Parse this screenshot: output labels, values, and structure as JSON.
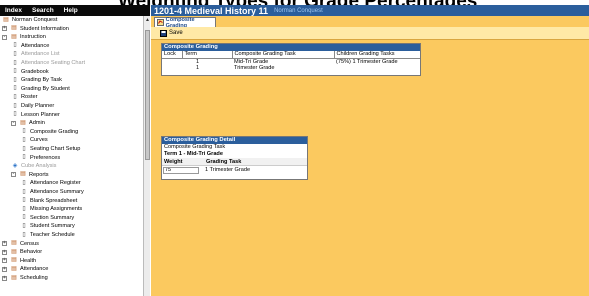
{
  "banner_text": "Weighting Types for Grade Percentages",
  "topnav": [
    "Index",
    "Search",
    "Help"
  ],
  "tree": {
    "items": [
      {
        "label": "Norman Conquest",
        "icon": "folder-icon",
        "level": 0,
        "toggle": "",
        "dim": false
      },
      {
        "label": "Student Information",
        "icon": "folder-icon",
        "level": 0,
        "toggle": "+",
        "dim": false
      },
      {
        "label": "Instruction",
        "icon": "folder-icon",
        "level": 0,
        "toggle": "-",
        "dim": false
      },
      {
        "label": "Attendance",
        "icon": "page-icon",
        "level": 1,
        "toggle": "",
        "dim": false
      },
      {
        "label": "Attendance List",
        "icon": "page-icon",
        "level": 1,
        "toggle": "",
        "dim": true
      },
      {
        "label": "Attendance Seating Chart",
        "icon": "page-icon",
        "level": 1,
        "toggle": "",
        "dim": true
      },
      {
        "label": "Gradebook",
        "icon": "page-icon",
        "level": 1,
        "toggle": "",
        "dim": false
      },
      {
        "label": "Grading By Task",
        "icon": "page-icon",
        "level": 1,
        "toggle": "",
        "dim": false
      },
      {
        "label": "Grading By Student",
        "icon": "page-icon",
        "level": 1,
        "toggle": "",
        "dim": false
      },
      {
        "label": "Roster",
        "icon": "page-icon",
        "level": 1,
        "toggle": "",
        "dim": false
      },
      {
        "label": "Daily Planner",
        "icon": "page-icon",
        "level": 1,
        "toggle": "",
        "dim": false
      },
      {
        "label": "Lesson Planner",
        "icon": "page-icon",
        "level": 1,
        "toggle": "",
        "dim": false
      },
      {
        "label": "Admin",
        "icon": "folder-icon",
        "level": 1,
        "toggle": "-",
        "dim": false
      },
      {
        "label": "Composite Grading",
        "icon": "page-icon",
        "level": 2,
        "toggle": "",
        "dim": false
      },
      {
        "label": "Curves",
        "icon": "page-icon",
        "level": 2,
        "toggle": "",
        "dim": false
      },
      {
        "label": "Seating Chart Setup",
        "icon": "page-icon",
        "level": 2,
        "toggle": "",
        "dim": false
      },
      {
        "label": "Preferences",
        "icon": "page-icon",
        "level": 2,
        "toggle": "",
        "dim": false
      },
      {
        "label": "Cube Analysis",
        "icon": "cube-icon",
        "level": 1,
        "toggle": "",
        "dim": true
      },
      {
        "label": "Reports",
        "icon": "folder-icon",
        "level": 1,
        "toggle": "-",
        "dim": false
      },
      {
        "label": "Attendance Register",
        "icon": "page-icon",
        "level": 2,
        "toggle": "",
        "dim": false
      },
      {
        "label": "Attendance Summary",
        "icon": "page-icon",
        "level": 2,
        "toggle": "",
        "dim": false
      },
      {
        "label": "Blank Spreadsheet",
        "icon": "page-icon",
        "level": 2,
        "toggle": "",
        "dim": false
      },
      {
        "label": "Missing Assignments",
        "icon": "page-icon",
        "level": 2,
        "toggle": "",
        "dim": false
      },
      {
        "label": "Section Summary",
        "icon": "page-icon",
        "level": 2,
        "toggle": "",
        "dim": false
      },
      {
        "label": "Student Summary",
        "icon": "page-icon",
        "level": 2,
        "toggle": "",
        "dim": false
      },
      {
        "label": "Teacher Schedule",
        "icon": "page-icon",
        "level": 2,
        "toggle": "",
        "dim": false
      },
      {
        "label": "Census",
        "icon": "folder-icon",
        "level": 0,
        "toggle": "+",
        "dim": false
      },
      {
        "label": "Behavior",
        "icon": "folder-icon",
        "level": 0,
        "toggle": "+",
        "dim": false
      },
      {
        "label": "Health",
        "icon": "folder-icon",
        "level": 0,
        "toggle": "+",
        "dim": false
      },
      {
        "label": "Attendance",
        "icon": "folder-icon",
        "level": 0,
        "toggle": "+",
        "dim": false
      },
      {
        "label": "Scheduling",
        "icon": "folder-icon",
        "level": 0,
        "toggle": "+",
        "dim": false
      }
    ]
  },
  "header": {
    "title": "1201-4 Medieval History 11",
    "subtitle": "Norman Conquest"
  },
  "tab_label": "Composite Grading",
  "toolbar": {
    "save_label": "Save"
  },
  "composite_panel": {
    "title": "Composite Grading",
    "columns": [
      "Lock",
      "Term",
      "Composite Grading Task",
      "Children Grading Tasks"
    ],
    "rows": [
      [
        "",
        "1",
        "Mid-Tri Grade",
        "(75%) 1 Trimester Grade"
      ],
      [
        "",
        "1",
        "Trimester Grade",
        ""
      ]
    ]
  },
  "detail_panel": {
    "title": "Composite Grading Detail",
    "task_label": "Composite Grading Task",
    "term_label": "Term 1 - Mid-Tri Grade",
    "col_weight": "Weight",
    "col_task": "Grading Task",
    "weight_value": "75",
    "task_value": "1 Trimester Grade"
  },
  "colors": {
    "header_blue": "#2b5e9c",
    "main_bg": "#fbc95f",
    "toolbar_bg": "#ffe9a6"
  }
}
